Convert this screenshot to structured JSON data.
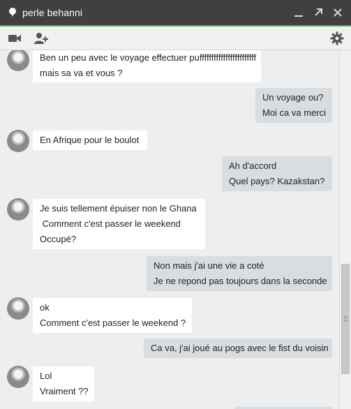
{
  "window": {
    "title": "perle behanni",
    "accent_color": "#4fb54a",
    "titlebar_color": "#404040"
  },
  "titlebar": {
    "icons": [
      "presence-pin-icon",
      "minimize-icon",
      "popout-icon"
    ]
  },
  "toolbar": {
    "icons": [
      "video-call-icon",
      "add-person-icon",
      "settings-gear-icon"
    ]
  },
  "messages": [
    {
      "from": "contact",
      "lines": [
        "Ben un peu avec le voyage effectuer puffffffffffffffffffffffff",
        "mais sa va et vous ?"
      ]
    },
    {
      "from": "me",
      "lines": [
        "Un voyage ou?",
        "Moi ca va merci"
      ]
    },
    {
      "from": "contact",
      "lines": [
        "En Afrique pour le boulot"
      ]
    },
    {
      "from": "me",
      "lines": [
        "Ah d'accord",
        "Quel pays? Kazakstan?"
      ]
    },
    {
      "from": "contact",
      "lines": [
        "Je suis tellement épuiser non le Ghana",
        " Comment c'est passer le weekend",
        "Occupé?"
      ]
    },
    {
      "from": "me",
      "lines": [
        "Non mais j'ai une vie a coté",
        "Je ne repond pas toujours dans la seconde"
      ]
    },
    {
      "from": "contact",
      "lines": [
        "ok",
        "Comment c'est passer le weekend ?"
      ]
    },
    {
      "from": "me",
      "lines": [
        "Ca va, j'ai joué au pogs avec le fist du voisin"
      ]
    },
    {
      "from": "contact",
      "lines": [
        "Lol",
        "Vraiment ??"
      ]
    },
    {
      "from": "me",
      "lines": []
    }
  ]
}
